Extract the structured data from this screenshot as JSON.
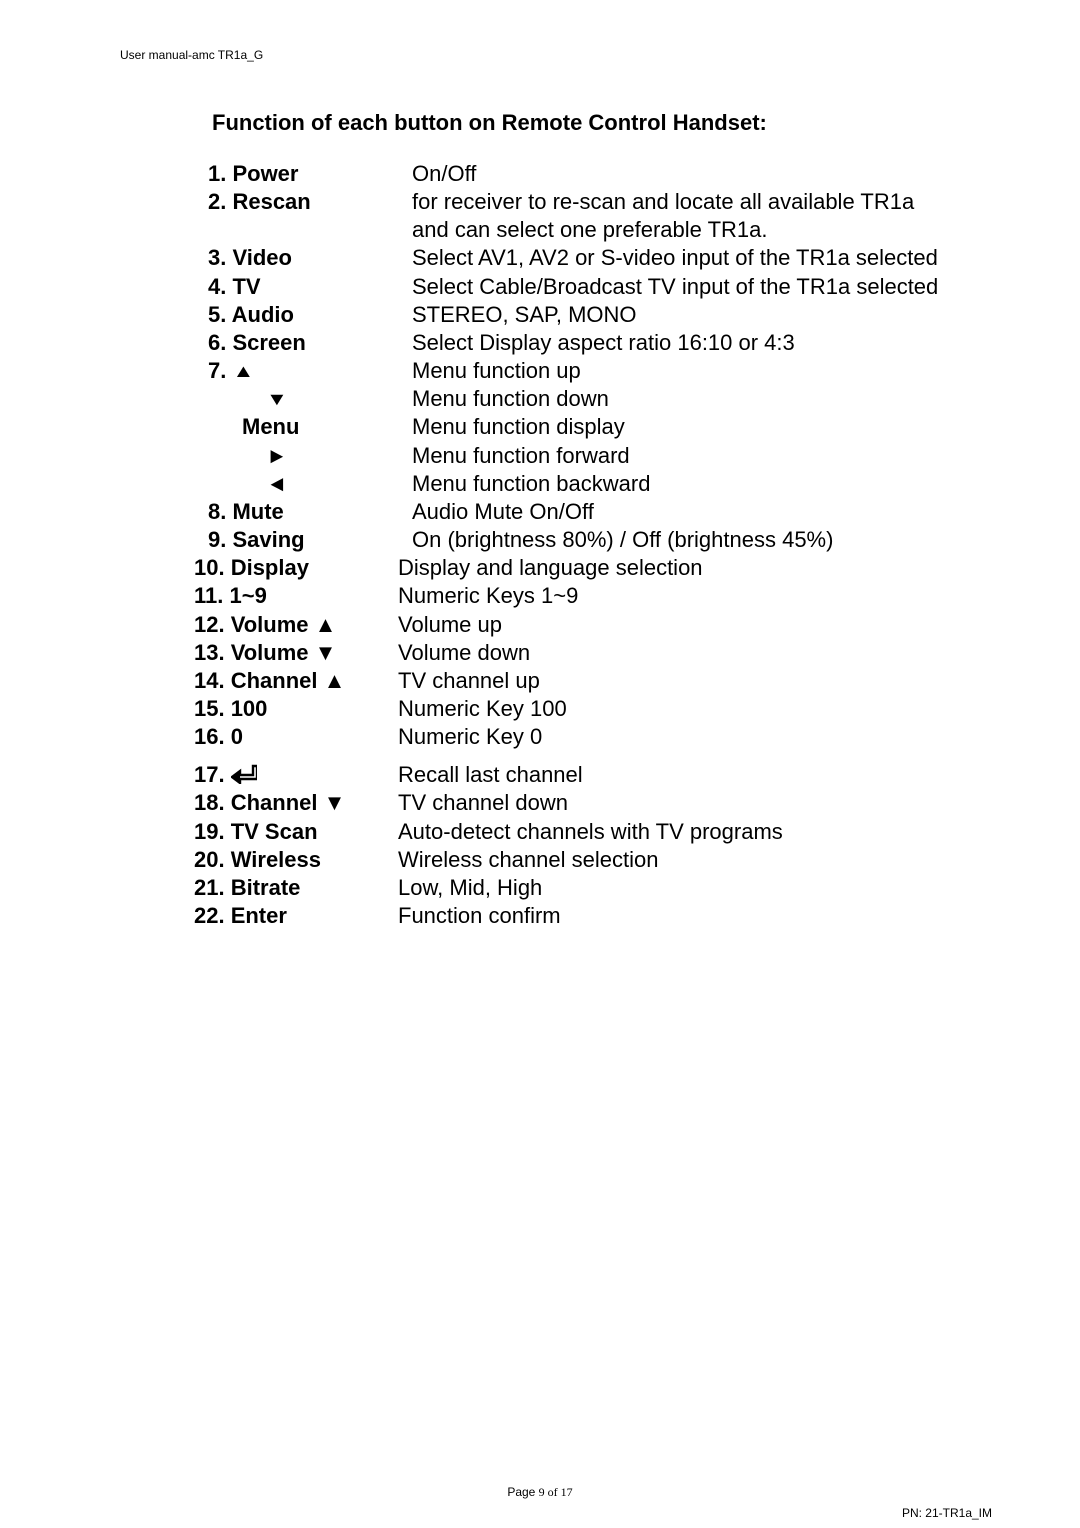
{
  "header": {
    "doc_name": "User manual-amc TR1a_G"
  },
  "title": "Function of each button on Remote Control Handset:",
  "items": [
    {
      "num": "1. ",
      "label": "Power",
      "desc": "On/Off"
    },
    {
      "num": "2. ",
      "label": "Rescan",
      "desc": "for receiver to re-scan and locate all available TR1a"
    },
    {
      "cont": true,
      "desc": "and can select one preferable TR1a."
    },
    {
      "num": "3. ",
      "label": "Video",
      "desc": "Select AV1, AV2 or S-video input of the TR1a selected"
    },
    {
      "num": "4. ",
      "label": "TV",
      "desc": "Select Cable/Broadcast TV input of the TR1a selected"
    },
    {
      "num": "5. ",
      "label": "Audio",
      "desc": "STEREO, SAP, MONO"
    },
    {
      "num": "6. ",
      "label": "Screen",
      "desc": "Select Display aspect ratio 16:10 or 4:3"
    },
    {
      "num": "7. ",
      "icon": "tri-up",
      "desc": "Menu function up"
    },
    {
      "indent": "more",
      "icon": "tri-down",
      "desc": "Menu function down"
    },
    {
      "indent": true,
      "label": "Menu",
      "desc": "Menu function display"
    },
    {
      "indent": "more",
      "icon": "tri-right",
      "desc": "Menu function forward"
    },
    {
      "indent": "more",
      "icon": "tri-left",
      "desc": "Menu function backward"
    },
    {
      "num": "8. ",
      "label": "Mute",
      "desc": "Audio Mute On/Off"
    },
    {
      "num": "9. ",
      "label": "Saving",
      "desc": "On (brightness 80%) / Off (brightness 45%)"
    },
    {
      "num": "10. ",
      "label": "Display",
      "desc": "Display and language selection",
      "shift": -14
    },
    {
      "num": "11. ",
      "label": "1~9",
      "desc": "Numeric Keys 1~9",
      "shift": -14
    },
    {
      "num": "12. ",
      "label": "Volume ▲",
      "desc": "Volume up",
      "shift": -14
    },
    {
      "num": "13. ",
      "label": "Volume ▼",
      "desc": "Volume down",
      "shift": -14
    },
    {
      "num": "14. ",
      "label": "Channel ▲",
      "desc": "TV channel up",
      "shift": -14
    },
    {
      "num": "15. ",
      "label": "100",
      "desc": "Numeric Key 100",
      "shift": -14
    },
    {
      "num": "16.    ",
      "label": "0",
      "desc": "Numeric Key   0",
      "shift": -14
    },
    {
      "gap": true
    },
    {
      "num": "17.   ",
      "icon": "return",
      "desc": "Recall last channel",
      "shift": -14
    },
    {
      "num": "18. ",
      "label": "Channel ▼",
      "desc": "TV channel down",
      "shift": -14
    },
    {
      "num": "19. ",
      "label": "TV Scan",
      "desc": "Auto-detect channels with TV programs",
      "shift": -14
    },
    {
      "num": "20. ",
      "label": "Wireless",
      "desc": "Wireless channel selection",
      "shift": -14
    },
    {
      "num": "21. ",
      "label": "Bitrate",
      "desc": "Low, Mid, High",
      "shift": -14
    },
    {
      "num": "22. ",
      "label": "Enter",
      "desc": "Function confirm",
      "shift": -14
    }
  ],
  "footer": {
    "page_label": "Page ",
    "page_cur": "9",
    "page_of": " of ",
    "page_total": "17",
    "pn": "PN: 21-TR1a_IM"
  },
  "icons": {
    "tri-up": "▲",
    "tri-down": "▼",
    "tri-right": "►",
    "tri-left": "◄"
  }
}
